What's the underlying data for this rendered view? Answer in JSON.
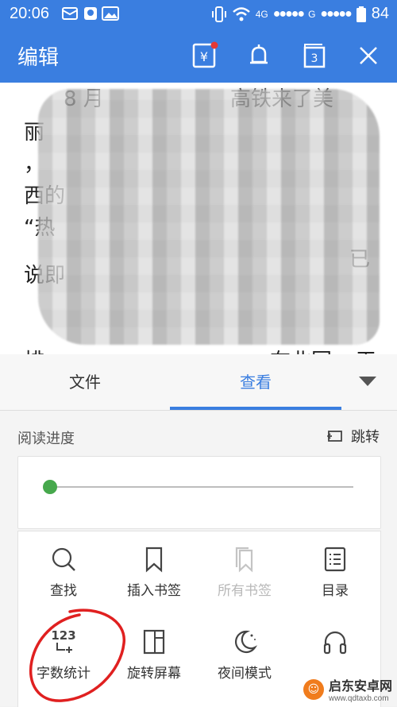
{
  "status_bar": {
    "time": "20:06",
    "network_4g": "4G",
    "network_g": "G",
    "battery": "84",
    "signal_dots": "●●●●●"
  },
  "app_bar": {
    "title": "编辑",
    "tabs_count": "3",
    "wallet_symbol": "¥"
  },
  "document": {
    "lines": [
      "8 月",
      "高铁来了美",
      "丽",
      "，",
      "西",
      "的",
      "“热",
      "说即",
      "已",
      "排",
      "在北国",
      "天"
    ]
  },
  "panel": {
    "tabs": [
      {
        "label": "文件",
        "selected": false
      },
      {
        "label": "查看",
        "selected": true
      }
    ],
    "reading_progress_label": "阅读进度",
    "jump_label": "跳转",
    "progress_fraction": 0.02,
    "tools": [
      {
        "label": "查找",
        "icon": "search-icon",
        "enabled": true
      },
      {
        "label": "插入书签",
        "icon": "bookmark-icon",
        "enabled": true
      },
      {
        "label": "所有书签",
        "icon": "bookmarks-icon",
        "enabled": false
      },
      {
        "label": "目录",
        "icon": "toc-icon",
        "enabled": true
      },
      {
        "label": "字数统计",
        "icon": "word-count-icon",
        "enabled": true,
        "icon_text": "123"
      },
      {
        "label": "旋转屏幕",
        "icon": "rotate-screen-icon",
        "enabled": true
      },
      {
        "label": "夜间模式",
        "icon": "night-mode-icon",
        "enabled": true
      },
      {
        "label": "",
        "icon": "headphones-icon",
        "enabled": true
      }
    ]
  },
  "watermark": {
    "name": "启东安卓网",
    "url": "www.qdtaxb.com"
  },
  "colors": {
    "primary": "#3a7ee0",
    "progress": "#4caf50",
    "annotation": "#e02020",
    "watermark": "#f07c1d"
  }
}
